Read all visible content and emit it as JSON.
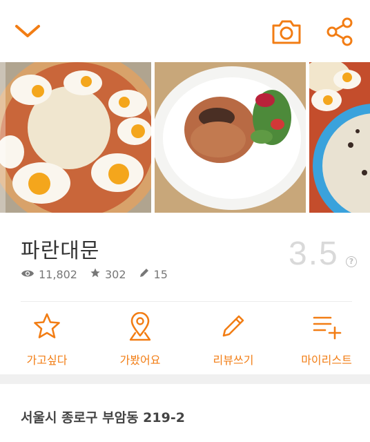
{
  "header": {
    "back_icon": "chevron-down-icon",
    "camera_icon": "camera-icon",
    "share_icon": "share-icon",
    "accent_color": "#f27d14"
  },
  "gallery": {
    "photos": [
      "pizza-photo",
      "risotto-salad-photo",
      "pizza-risotto-photo"
    ]
  },
  "restaurant": {
    "name": "파란대문",
    "views": "11,802",
    "stars": "302",
    "reviews": "15",
    "rating": "3.5",
    "rating_help": "?"
  },
  "actions": [
    {
      "label": "가고싶다",
      "icon": "star-icon"
    },
    {
      "label": "가봤어요",
      "icon": "map-pin-icon"
    },
    {
      "label": "리뷰쓰기",
      "icon": "pencil-icon"
    },
    {
      "label": "마이리스트",
      "icon": "list-add-icon"
    }
  ],
  "address": "서울시 종로구 부암동 219-2"
}
